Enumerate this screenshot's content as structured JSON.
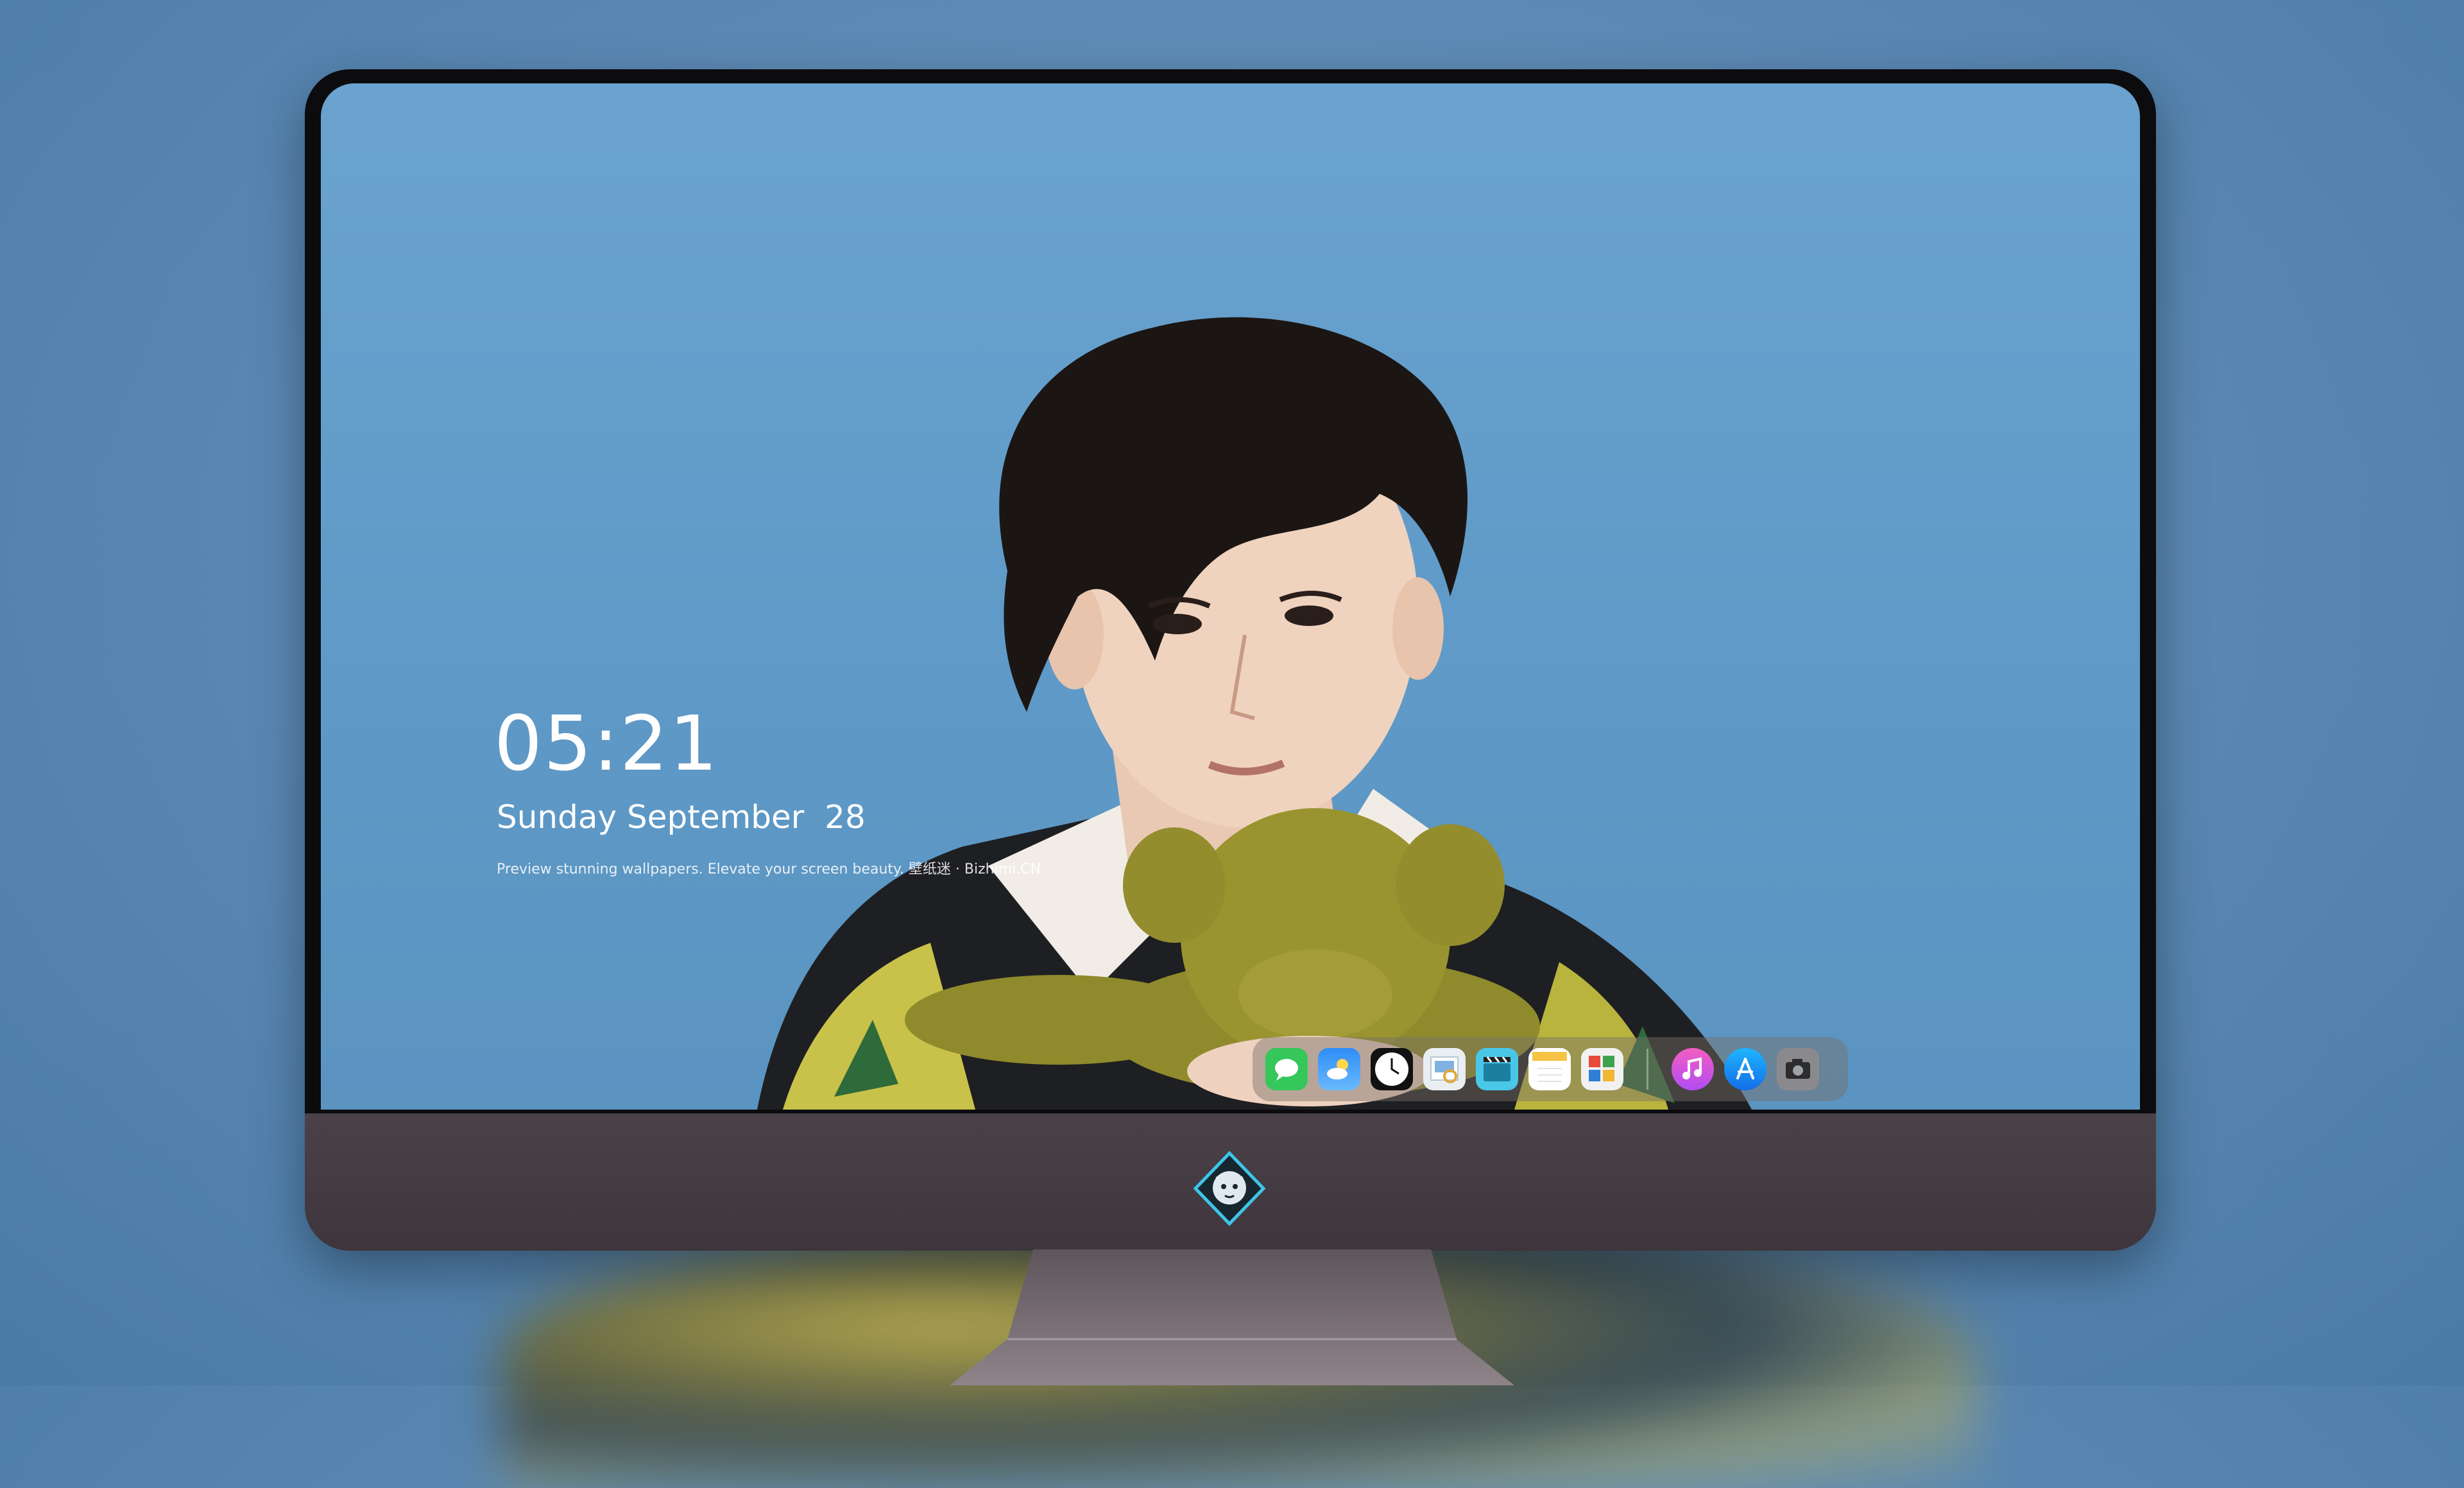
{
  "lockscreen": {
    "time": "05:21",
    "date": "Sunday September  28",
    "tagline": "Preview stunning wallpapers. Elevate your screen beauty. 壁纸迷 · Bizhimi.CN"
  },
  "dock": {
    "apps": [
      {
        "name": "messages-icon"
      },
      {
        "name": "weather-icon"
      },
      {
        "name": "clock-icon"
      },
      {
        "name": "preview-icon"
      },
      {
        "name": "video-icon"
      },
      {
        "name": "notes-icon"
      },
      {
        "name": "photos-grid-icon"
      },
      {
        "name": "music-icon"
      },
      {
        "name": "app-store-icon"
      },
      {
        "name": "camera-icon"
      }
    ]
  },
  "colors": {
    "wallpaper_bg": "#5e99c7",
    "monitor_bezel": "#0c0c0f",
    "monitor_chin": "#453d43"
  }
}
